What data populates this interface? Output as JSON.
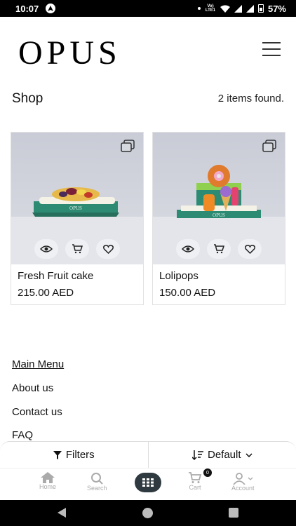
{
  "status_bar": {
    "time": "10:07",
    "network_label": "Vo) LTE1",
    "battery": "57%"
  },
  "header": {
    "logo": "OPUS",
    "menu_icon": "hamburger-icon"
  },
  "shop": {
    "title": "Shop",
    "count_text": "2 items found."
  },
  "products": [
    {
      "name": "Fresh Fruit cake",
      "price": "215.00 AED",
      "box_label": "OPUS"
    },
    {
      "name": "Lolipops",
      "price": "150.00 AED",
      "box_label": "OPUS"
    }
  ],
  "footer_menu": {
    "heading": "Main Menu",
    "links": [
      "About us",
      "Contact us",
      "FAQ"
    ]
  },
  "filter_bar": {
    "filters_label": "Filters",
    "sort_label": "Default"
  },
  "bottom_nav": {
    "items": [
      {
        "label": "Home",
        "icon": "home-icon"
      },
      {
        "label": "Search",
        "icon": "search-icon"
      },
      {
        "label": "",
        "icon": "grid-icon"
      },
      {
        "label": "Cart",
        "icon": "cart-icon",
        "badge": "0"
      },
      {
        "label": "Account",
        "icon": "account-icon"
      }
    ]
  },
  "colors": {
    "accent_dark": "#2f3a40",
    "card_border": "#e2e2e2",
    "box_green": "#2e8b73"
  }
}
